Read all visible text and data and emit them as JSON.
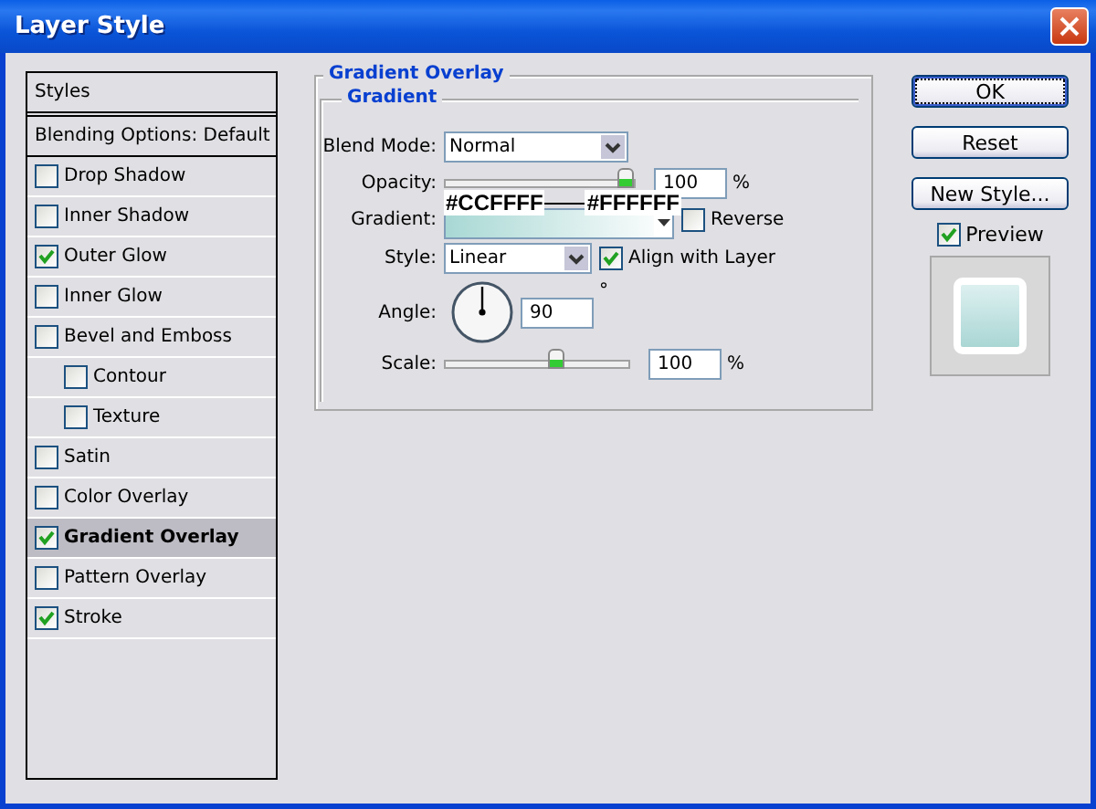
{
  "window": {
    "title": "Layer Style"
  },
  "sidebar": {
    "items": [
      {
        "kind": "header",
        "label": "Styles",
        "selected": false
      },
      {
        "kind": "header",
        "label": "Blending Options: Default",
        "selected": false
      },
      {
        "kind": "check",
        "label": "Drop Shadow",
        "checked": false,
        "selected": false
      },
      {
        "kind": "check",
        "label": "Inner Shadow",
        "checked": false,
        "selected": false
      },
      {
        "kind": "check",
        "label": "Outer Glow",
        "checked": true,
        "selected": false
      },
      {
        "kind": "check",
        "label": "Inner Glow",
        "checked": false,
        "selected": false
      },
      {
        "kind": "check",
        "label": "Bevel and Emboss",
        "checked": false,
        "selected": false,
        "children": [
          {
            "kind": "check",
            "label": "Contour",
            "checked": false,
            "selected": false
          },
          {
            "kind": "check",
            "label": "Texture",
            "checked": false,
            "selected": false
          }
        ]
      },
      {
        "kind": "check",
        "label": "Satin",
        "checked": false,
        "selected": false
      },
      {
        "kind": "check",
        "label": "Color Overlay",
        "checked": false,
        "selected": false
      },
      {
        "kind": "check",
        "label": "Gradient Overlay",
        "checked": true,
        "selected": true
      },
      {
        "kind": "check",
        "label": "Pattern Overlay",
        "checked": false,
        "selected": false
      },
      {
        "kind": "check",
        "label": "Stroke",
        "checked": true,
        "selected": false
      }
    ]
  },
  "panel": {
    "title": "Gradient Overlay",
    "group_title": "Gradient",
    "blend_mode": {
      "label": "Blend Mode:",
      "value": "Normal"
    },
    "opacity": {
      "label": "Opacity:",
      "level": 1.0,
      "value": "100",
      "unit": "%"
    },
    "gradient": {
      "label": "Gradient:",
      "annotations": [
        "#CCFFFF",
        "#FFFFFF"
      ]
    },
    "reverse": {
      "label": "Reverse",
      "checked": false
    },
    "style": {
      "label": "Style:",
      "value": "Linear"
    },
    "align": {
      "label": "Align with Layer",
      "checked": true
    },
    "angle": {
      "label": "Angle:",
      "value": "90",
      "unit": "°"
    },
    "scale": {
      "label": "Scale:",
      "level": 0.62,
      "value": "100",
      "unit": "%"
    }
  },
  "buttons": [
    {
      "label": "OK",
      "default": true
    },
    {
      "label": "Reset",
      "default": false
    },
    {
      "label": "New Style...",
      "default": false
    }
  ],
  "preview": {
    "label": "Preview",
    "checked": true
  }
}
